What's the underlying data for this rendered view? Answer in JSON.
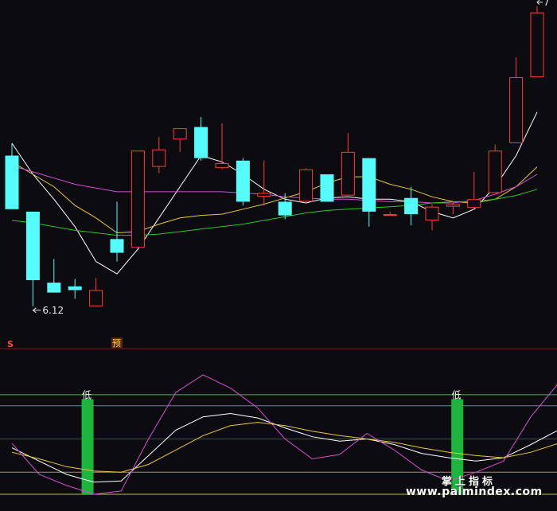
{
  "colors": {
    "background": "#0c0b0f",
    "up_candle": "#ff3b3b",
    "down_candle": "#54fcfc",
    "ma_short": "#ffffff",
    "ma_mid": "#e8c83a",
    "ma_long": "#d34fd3",
    "ma_longer": "#2fc42f",
    "divider": "#7a1818",
    "k_line": "#ffffff",
    "d_line": "#e8c83a",
    "j_line": "#d34fd3",
    "low_bar": "#1cb63c"
  },
  "chart_data": [
    {
      "type": "candlestick",
      "name": "price",
      "y_range": [
        5.8,
        8.6
      ],
      "annotations": {
        "low_price": "6.12",
        "high_price": "7",
        "bottom_left_marker": "S",
        "pre_marker": "预"
      },
      "candles": [
        {
          "open": 7.35,
          "high": 7.45,
          "low": 6.92,
          "close": 6.92
        },
        {
          "open": 6.9,
          "high": 6.9,
          "low": 6.14,
          "close": 6.35
        },
        {
          "open": 6.33,
          "high": 6.52,
          "low": 6.28,
          "close": 6.25
        },
        {
          "open": 6.3,
          "high": 6.36,
          "low": 6.2,
          "close": 6.27
        },
        {
          "open": 6.14,
          "high": 6.37,
          "low": 6.14,
          "close": 6.27
        },
        {
          "open": 6.68,
          "high": 6.98,
          "low": 6.5,
          "close": 6.57
        },
        {
          "open": 6.61,
          "high": 7.39,
          "low": 6.61,
          "close": 7.39
        },
        {
          "open": 7.26,
          "high": 7.5,
          "low": 7.21,
          "close": 7.4
        },
        {
          "open": 7.48,
          "high": 7.55,
          "low": 7.38,
          "close": 7.57
        },
        {
          "open": 7.58,
          "high": 7.66,
          "low": 7.31,
          "close": 7.33
        },
        {
          "open": 7.25,
          "high": 7.61,
          "low": 7.24,
          "close": 7.29
        },
        {
          "open": 7.31,
          "high": 7.33,
          "low": 6.95,
          "close": 6.98
        },
        {
          "open": 7.02,
          "high": 7.31,
          "low": 6.95,
          "close": 7.05
        },
        {
          "open": 6.98,
          "high": 7.05,
          "low": 6.84,
          "close": 6.87
        },
        {
          "open": 6.98,
          "high": 7.25,
          "low": 6.97,
          "close": 7.24
        },
        {
          "open": 7.2,
          "high": 7.2,
          "low": 6.98,
          "close": 6.98
        },
        {
          "open": 7.03,
          "high": 7.53,
          "low": 7.03,
          "close": 7.38
        },
        {
          "open": 7.33,
          "high": 7.33,
          "low": 6.78,
          "close": 6.9
        },
        {
          "open": 6.88,
          "high": 6.9,
          "low": 6.87,
          "close": 6.88
        },
        {
          "open": 7.01,
          "high": 7.1,
          "low": 6.79,
          "close": 6.88
        },
        {
          "open": 6.83,
          "high": 6.96,
          "low": 6.75,
          "close": 6.94
        },
        {
          "open": 6.94,
          "high": 6.98,
          "low": 6.88,
          "close": 6.96
        },
        {
          "open": 6.93,
          "high": 7.22,
          "low": 6.93,
          "close": 7.0
        },
        {
          "open": 7.05,
          "high": 7.44,
          "low": 7.05,
          "close": 7.39
        },
        {
          "open": 7.45,
          "high": 8.14,
          "low": 7.45,
          "close": 7.98
        },
        {
          "open": 7.98,
          "high": 8.55,
          "low": 7.98,
          "close": 8.5
        }
      ],
      "ma_lines": [
        {
          "key": "ma_short",
          "values": [
            7.45,
            7.2,
            7.0,
            6.78,
            6.5,
            6.4,
            6.6,
            6.85,
            7.1,
            7.35,
            7.3,
            7.2,
            7.08,
            7.0,
            6.97,
            7.01,
            7.02,
            7.0,
            7.0,
            6.98,
            6.9,
            6.85,
            6.92,
            7.1,
            7.35,
            7.7
          ]
        },
        {
          "key": "ma_mid",
          "values": [
            7.3,
            7.2,
            7.1,
            6.95,
            6.85,
            6.73,
            6.74,
            6.8,
            6.85,
            6.87,
            6.88,
            6.92,
            6.96,
            7.01,
            7.06,
            7.13,
            7.18,
            7.18,
            7.12,
            7.08,
            7.02,
            6.98,
            6.97,
            7.0,
            7.1,
            7.26
          ]
        },
        {
          "key": "ma_long",
          "values": [
            7.27,
            7.22,
            7.17,
            7.12,
            7.09,
            7.06,
            7.06,
            7.06,
            7.06,
            7.06,
            7.06,
            7.05,
            7.04,
            7.02,
            7.01,
            7.0,
            7.0,
            6.99,
            6.98,
            6.98,
            6.97,
            6.97,
            6.99,
            7.04,
            7.1,
            7.2
          ]
        },
        {
          "key": "ma_longer",
          "values": [
            6.83,
            6.81,
            6.78,
            6.75,
            6.73,
            6.71,
            6.71,
            6.72,
            6.74,
            6.76,
            6.78,
            6.8,
            6.83,
            6.86,
            6.89,
            6.91,
            6.92,
            6.93,
            6.94,
            6.95,
            6.97,
            6.98,
            6.98,
            7.0,
            7.03,
            7.08
          ]
        }
      ]
    },
    {
      "type": "line",
      "name": "indicator",
      "y_range": [
        0,
        100
      ],
      "reference_lines": [
        {
          "value": 90,
          "color": "#2fc42f"
        },
        {
          "value": 80,
          "color": "#2aa3a3"
        },
        {
          "value": 50,
          "color": "#2f3ad8"
        },
        {
          "value": 20,
          "color": "#e06f85"
        },
        {
          "value": 0,
          "color": "#b8c64d"
        }
      ],
      "low_signals": [
        {
          "index": 3.6,
          "label": "低"
        },
        {
          "index": 21.2,
          "label": "低"
        }
      ],
      "x": [
        0,
        1.3,
        2.6,
        3.9,
        5.2,
        6.5,
        7.8,
        9.1,
        10.4,
        11.7,
        13,
        14.3,
        15.6,
        16.9,
        18.2,
        19.5,
        20.8,
        22.1,
        23.4,
        24.7,
        26
      ],
      "series": [
        {
          "key": "k_line",
          "values": [
            42,
            30,
            18,
            11,
            12,
            35,
            58,
            70,
            73,
            69,
            60,
            52,
            48,
            50,
            45,
            37,
            33,
            30,
            33,
            45,
            58
          ]
        },
        {
          "key": "d_line",
          "values": [
            38,
            32,
            25,
            21,
            20,
            27,
            40,
            53,
            62,
            65,
            62,
            57,
            53,
            50,
            47,
            42,
            38,
            35,
            33,
            38,
            46
          ]
        },
        {
          "key": "j_line",
          "values": [
            46,
            18,
            8,
            0,
            3,
            50,
            92,
            108,
            96,
            78,
            50,
            32,
            36,
            55,
            40,
            22,
            12,
            20,
            30,
            70,
            100
          ]
        }
      ]
    }
  ],
  "watermark": {
    "line1": "掌上指标",
    "line2": "www.palmindex.com"
  }
}
